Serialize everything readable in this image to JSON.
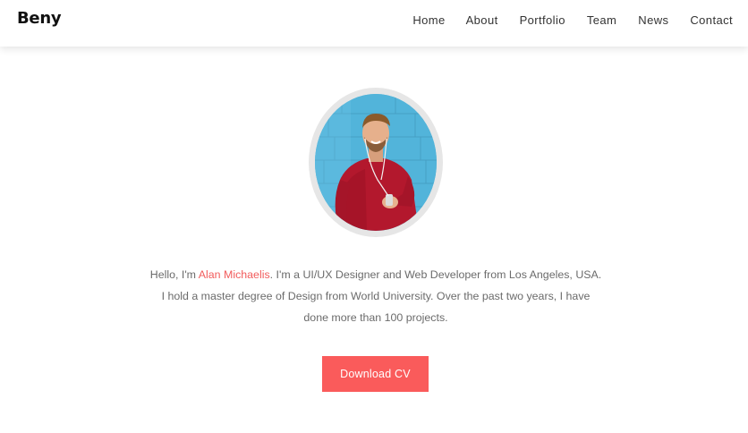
{
  "brand": "Beny",
  "nav": {
    "items": [
      "Home",
      "About",
      "Portfolio",
      "Team",
      "News",
      "Contact"
    ]
  },
  "profile": {
    "avatar_icon": "profile-photo-man-red-sweater"
  },
  "bio": {
    "greeting": "Hello, I'm ",
    "name": "Alan Michaelis",
    "line1_rest": ". I'm a UI/UX Designer and Web Developer from Los Angeles, USA.",
    "line2": "I hold a master degree of Design from World University. Over the past two years, I have",
    "line3": "done more than 100 projects."
  },
  "cta": {
    "label": "Download CV"
  },
  "colors": {
    "accent": "#fa5b5b",
    "text": "#6b6b6b",
    "nav_text": "#333333"
  }
}
